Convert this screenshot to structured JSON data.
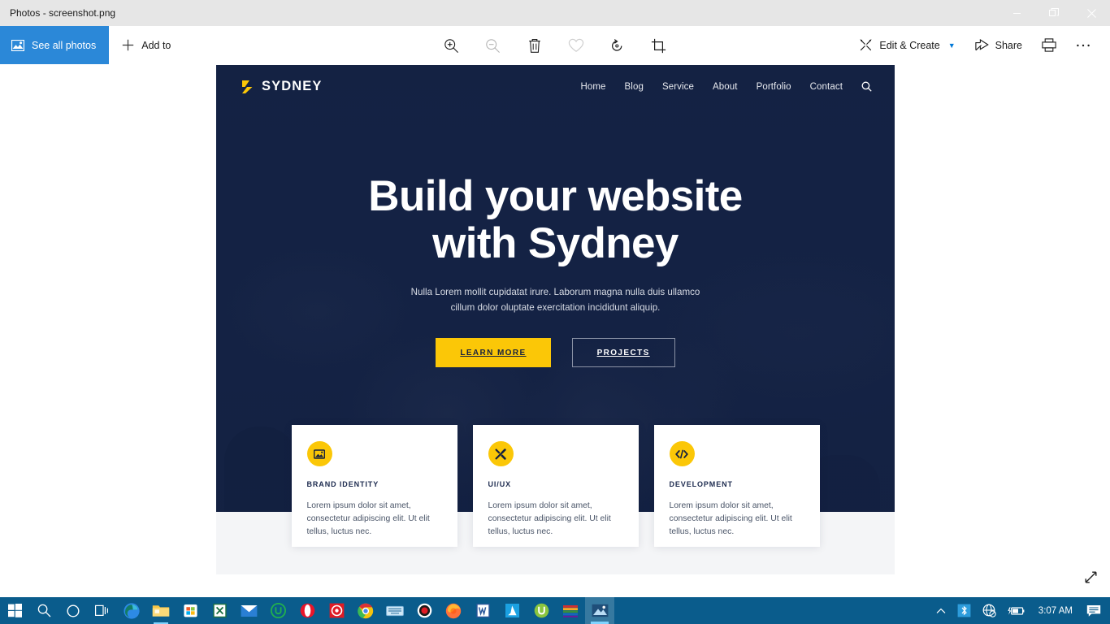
{
  "window": {
    "title": "Photos - screenshot.png",
    "controls": [
      {
        "name": "minimize",
        "glyph": "minimize-icon"
      },
      {
        "name": "restore",
        "glyph": "restore-icon"
      },
      {
        "name": "close",
        "glyph": "close-icon"
      }
    ]
  },
  "commandbar": {
    "see_all_photos": "See all photos",
    "add_to": "Add to",
    "center_tools": [
      {
        "name": "zoom-in-icon",
        "disabled": false
      },
      {
        "name": "zoom-out-icon",
        "disabled": true
      },
      {
        "name": "delete-icon",
        "disabled": false
      },
      {
        "name": "favorite-heart-icon",
        "disabled": false
      },
      {
        "name": "rotate-icon",
        "disabled": false
      },
      {
        "name": "crop-icon",
        "disabled": false
      }
    ],
    "edit_create": "Edit & Create",
    "share": "Share",
    "print_icon": "print-icon",
    "more_icon": "more-options-icon"
  },
  "site": {
    "brand": "SYDNEY",
    "nav": [
      "Home",
      "Blog",
      "Service",
      "About",
      "Portfolio",
      "Contact"
    ],
    "search_icon": "search-icon",
    "hero": {
      "title_line1": "Build your website",
      "title_line2": "with Sydney",
      "sub_line1": "Nulla Lorem mollit cupidatat irure. Laborum magna nulla duis ullamco",
      "sub_line2": "cillum dolor oluptate exercitation incididunt aliquip.",
      "primary_button": "LEARN MORE",
      "secondary_button": "PROJECTS"
    },
    "cards": [
      {
        "icon": "image-icon",
        "title": "BRAND IDENTITY",
        "text": "Lorem ipsum dolor sit amet, consectetur adipiscing elit. Ut elit tellus, luctus nec."
      },
      {
        "icon": "tools-icon",
        "title": "UI/UX",
        "text": "Lorem ipsum dolor sit amet, consectetur adipiscing elit. Ut elit tellus, luctus nec."
      },
      {
        "icon": "code-icon",
        "title": "DEVELOPMENT",
        "text": "Lorem ipsum dolor sit amet, consectetur adipiscing elit. Ut elit tellus, luctus nec."
      }
    ],
    "colors": {
      "accent_yellow": "#fbc707",
      "navy": "#16213f",
      "light_gray": "#f4f5f7"
    }
  },
  "taskbar": {
    "items": [
      {
        "name": "start-button"
      },
      {
        "name": "search-button"
      },
      {
        "name": "cortana-button"
      },
      {
        "name": "task-view-button"
      },
      {
        "name": "edge-icon"
      },
      {
        "name": "file-explorer-icon"
      },
      {
        "name": "microsoft-store-icon"
      },
      {
        "name": "excel-icon"
      },
      {
        "name": "mail-icon"
      },
      {
        "name": "utorrent-green-icon"
      },
      {
        "name": "opera-icon"
      },
      {
        "name": "target-red-icon"
      },
      {
        "name": "chrome-icon"
      },
      {
        "name": "keyboard-icon"
      },
      {
        "name": "record-icon"
      },
      {
        "name": "firefox-icon"
      },
      {
        "name": "word-icon"
      },
      {
        "name": "azure-icon"
      },
      {
        "name": "utorrent-icon"
      },
      {
        "name": "winrar-icon"
      },
      {
        "name": "photos-icon"
      }
    ],
    "tray": {
      "show_hidden_icon": "chevron-up-icon",
      "bluetooth_icon": "bluetooth-icon",
      "network_icon": "network-disconnected-icon",
      "battery_icon": "battery-charging-icon",
      "clock": "3:07 AM",
      "notifications_icon": "notifications-icon"
    }
  },
  "viewer": {
    "expand_icon": "expand-diagonal-icon"
  }
}
